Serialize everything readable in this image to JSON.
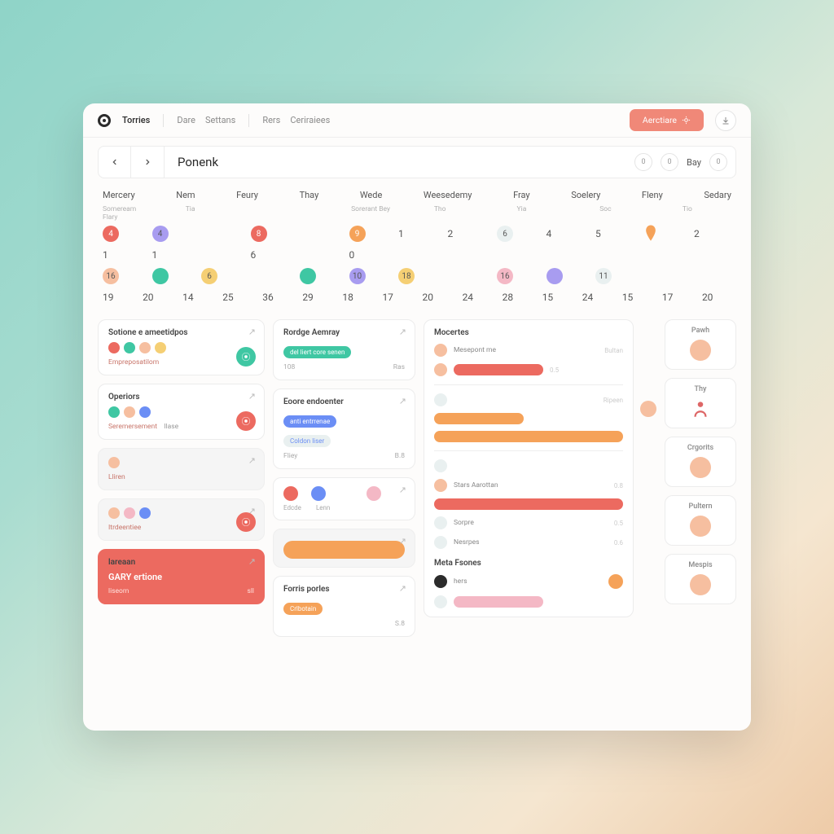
{
  "colors": {
    "primary": "#f08878",
    "red": "#ec6a60",
    "teal": "#3fc7a3",
    "yellow": "#f5cf74",
    "orange": "#f5a259",
    "blue": "#6b8ef5",
    "violet": "#a89cf0",
    "pink": "#f4b8c5",
    "peach": "#f6bfa0",
    "light": "#e9f0f0"
  },
  "topnav": {
    "tabs": [
      "Torries",
      "Dare",
      "Settans",
      "Rers",
      "Ceriraiees"
    ],
    "primary_button": "Aerctiare",
    "download_title": "Download"
  },
  "subbar": {
    "title": "Ponenk",
    "right_label": "Bay",
    "bubble_a": "0",
    "bubble_b": "0",
    "bubble_c": "0"
  },
  "dayheads": [
    "Mercery",
    "Nem",
    "Feury",
    "Thay",
    "Wede",
    "Weesedemy",
    "Fray",
    "Soelery",
    "Fleny",
    "Sedary"
  ],
  "subheads": [
    "Someream Flary",
    "Tia",
    "",
    "Sorerant Bey",
    "Tho",
    "Yia",
    "Soc",
    "Tio"
  ],
  "calendar": {
    "row1": [
      {
        "t": "dot",
        "v": "4",
        "c": "red"
      },
      {
        "t": "dot",
        "v": "4",
        "c": "violet",
        "muted": true
      },
      {
        "t": "empty"
      },
      {
        "t": "dot",
        "v": "8",
        "c": "red"
      },
      {
        "t": "empty"
      },
      {
        "t": "dot",
        "v": "9",
        "c": "orange"
      },
      {
        "t": "num",
        "v": "1"
      },
      {
        "t": "num",
        "v": "2"
      },
      {
        "t": "dot",
        "v": "6",
        "c": "light",
        "muted": true
      },
      {
        "t": "num",
        "v": "4"
      },
      {
        "t": "num",
        "v": "5"
      },
      {
        "t": "marker"
      },
      {
        "t": "num",
        "v": "2"
      }
    ],
    "row2": [
      {
        "t": "num",
        "v": "1"
      },
      {
        "t": "num",
        "v": "1"
      },
      {
        "t": "empty"
      },
      {
        "t": "num",
        "v": "6"
      },
      {
        "t": "empty"
      },
      {
        "t": "num",
        "v": "0"
      },
      {
        "t": "empty"
      },
      {
        "t": "empty"
      },
      {
        "t": "empty"
      },
      {
        "t": "empty"
      },
      {
        "t": "empty"
      },
      {
        "t": "empty"
      },
      {
        "t": "empty"
      }
    ],
    "row3": [
      {
        "t": "dot",
        "v": "16",
        "c": "peach",
        "muted": true
      },
      {
        "t": "dot",
        "v": "",
        "c": "teal"
      },
      {
        "t": "dot",
        "v": "6",
        "c": "yellow",
        "muted": true
      },
      {
        "t": "empty"
      },
      {
        "t": "dot",
        "v": "",
        "c": "teal"
      },
      {
        "t": "dot",
        "v": "10",
        "c": "violet",
        "muted": true
      },
      {
        "t": "dot",
        "v": "18",
        "c": "yellow",
        "muted": true
      },
      {
        "t": "empty"
      },
      {
        "t": "dot",
        "v": "16",
        "c": "pink",
        "muted": true
      },
      {
        "t": "dot",
        "v": "",
        "c": "violet"
      },
      {
        "t": "dot",
        "v": "11",
        "c": "light",
        "muted": true
      },
      {
        "t": "empty"
      },
      {
        "t": "empty"
      }
    ],
    "row4": [
      "19",
      "20",
      "14",
      "25",
      "36",
      "29",
      "18",
      "17",
      "20",
      "24",
      "28",
      "15",
      "24",
      "15",
      "17",
      "20"
    ]
  },
  "left_cards": [
    {
      "title": "Sotione e ameetidpos",
      "sub": "Empreposatilom",
      "avatars": [
        "red",
        "teal",
        "peach",
        "yellow"
      ],
      "fab": "teal"
    },
    {
      "title": "Operiors",
      "sub": "Seremersement",
      "sub2": "llase",
      "avatars": [
        "teal",
        "peach",
        "blue"
      ],
      "fab": "red"
    },
    {
      "title": "",
      "sub": "Lliren",
      "avatars": [
        "peach"
      ],
      "soft": true
    },
    {
      "title": "",
      "sub": "Itrdeentiee",
      "avatars": [
        "peach",
        "pink",
        "blue"
      ],
      "fab": "red",
      "soft": true
    },
    {
      "title": "lareaan",
      "line2": "GARY ertione",
      "sub": "liseom",
      "meta": "sll",
      "red": true
    }
  ],
  "mid_cards": [
    {
      "title": "Rordge Aemray",
      "pill": {
        "text": "del liert core senen",
        "c": "teal"
      },
      "foot_l": "108",
      "foot_r": "Ras"
    },
    {
      "title": "Eoore endoenter",
      "pills": [
        {
          "text": "anti entrrenae",
          "c": "blue"
        },
        {
          "text": "Coldon liser",
          "c": "light",
          "txt": "#6b8ef5"
        }
      ],
      "foot_l": "Fliey",
      "foot_r": "B.8"
    },
    {
      "dots": [
        "red",
        "blue",
        "",
        "pink"
      ],
      "labels": [
        "Edcde",
        "Lenn"
      ]
    },
    {
      "bar": {
        "c": "orange"
      },
      "soft": true
    },
    {
      "title": "Forris porles",
      "pill": {
        "text": "Crlbotain",
        "c": "orange"
      },
      "foot_r": "S.8"
    }
  ],
  "feed": {
    "title": "Mocertes",
    "items": [
      {
        "av": "peach",
        "txt": "Mesepont me",
        "meta": "Bultan"
      },
      {
        "av": "peach",
        "bar": "red",
        "meta": "0.5"
      },
      {
        "hr": true
      },
      {
        "av": "light",
        "txt": "",
        "meta": "Ripeen"
      },
      {
        "bar": "orange"
      },
      {
        "bar": "orange",
        "wide": true
      },
      {
        "hr": true
      },
      {
        "av": "light",
        "txt": ""
      },
      {
        "av": "peach",
        "txt": "Stars Aarottan",
        "meta": "0.8"
      },
      {
        "bar": "red",
        "wide": true
      },
      {
        "av": "light",
        "txt": "Sorpre",
        "meta": "0.5"
      },
      {
        "av": "light",
        "txt": "Nesrpes",
        "meta": "0.6"
      },
      {
        "section": "Meta Fsones"
      },
      {
        "av": "dark",
        "txt": "hers",
        "fab": "orange"
      },
      {
        "av": "light",
        "bar": "pink",
        "short": true
      }
    ],
    "side_av": "peach"
  },
  "side": [
    {
      "title": "Pawh",
      "av": "peach"
    },
    {
      "title": "Thy",
      "icon": "person"
    },
    {
      "title": "Crgorits",
      "av": "peach"
    },
    {
      "title": "Pultern",
      "av": "peach"
    },
    {
      "title": "Mespis",
      "av": "peach"
    }
  ]
}
